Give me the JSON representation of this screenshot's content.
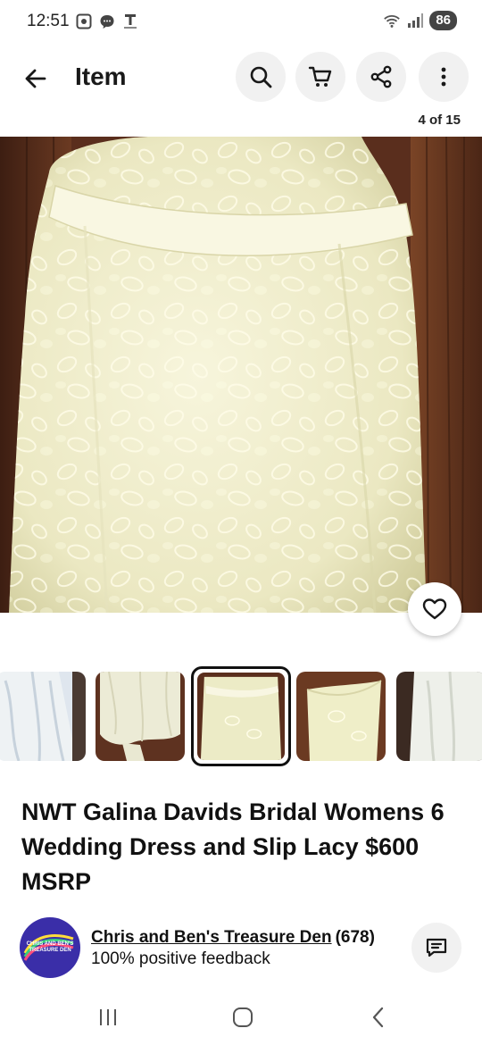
{
  "status_bar": {
    "time": "12:51",
    "battery": "86",
    "icons_left": [
      "screenshot-icon",
      "chat-bubble-icon",
      "t-mobile-icon"
    ],
    "icons_right": [
      "wifi-icon",
      "signal-icon"
    ]
  },
  "app_bar": {
    "title": "Item",
    "actions": [
      "search-icon",
      "cart-icon",
      "share-icon",
      "more-icon"
    ]
  },
  "gallery": {
    "counter": "4 of 15",
    "selected_index": 2,
    "thumbnails": [
      "dress-lace-skirt",
      "dress-skirt-hem",
      "dress-front",
      "dress-bodice",
      "dress-side"
    ]
  },
  "item": {
    "title": "NWT Galina Davids Bridal Womens 6 Wedding Dress and Slip Lacy $600 MSRP"
  },
  "seller": {
    "name": "Chris and Ben's Treasure Den",
    "count": "(678)",
    "feedback": "100% positive feedback",
    "avatar_text": "CHRIS AND BEN'S TREASURE DEN"
  },
  "colors": {
    "accent": "#191919",
    "button_bg": "#f1f1f1",
    "avatar_bg": "#3a2ea8",
    "wood": "#5a2e1d",
    "dress": "#f3f1d6"
  }
}
